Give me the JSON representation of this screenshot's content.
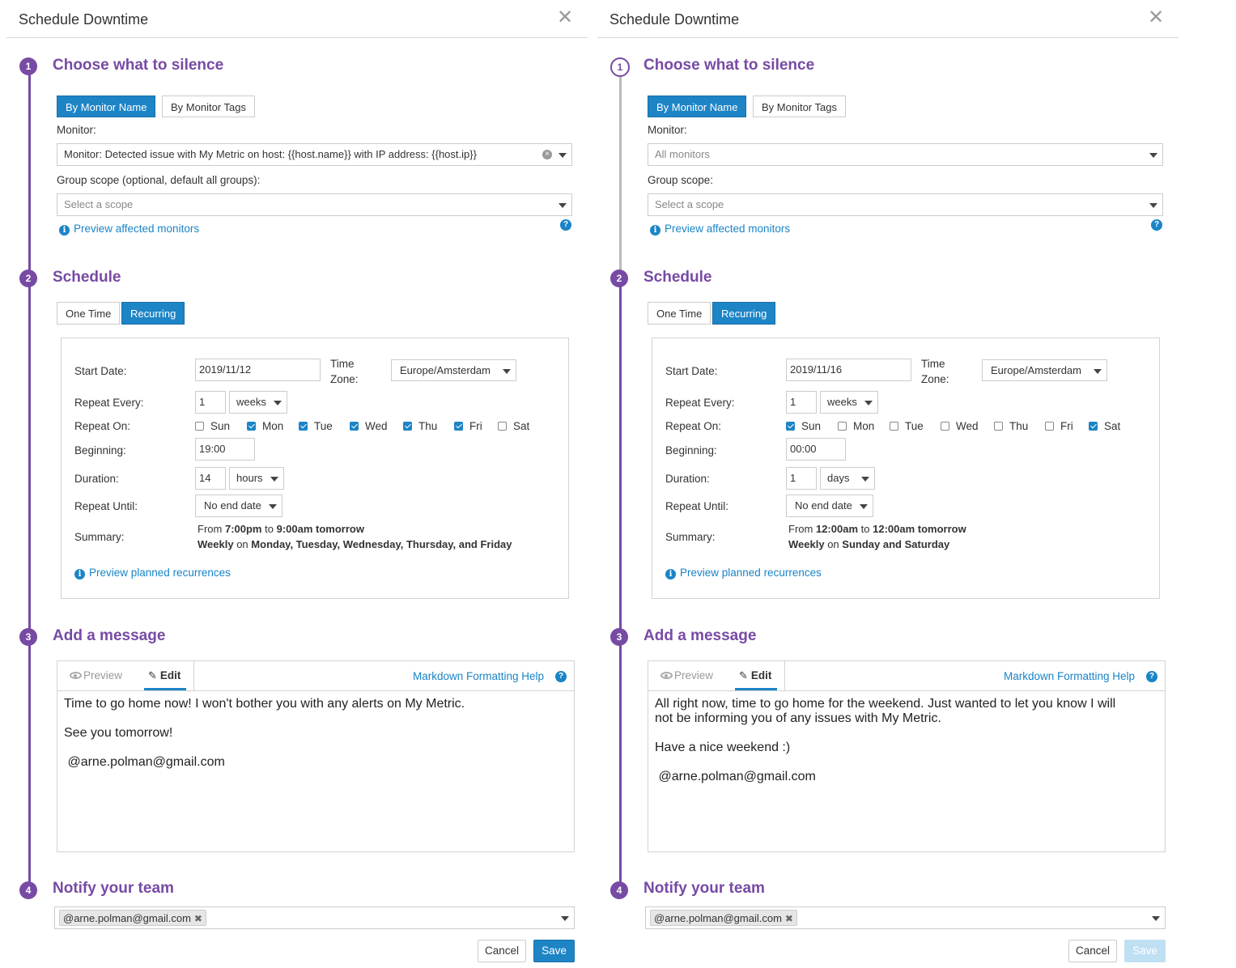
{
  "colors": {
    "accent": "#774aa4",
    "primary": "#1d84c6",
    "link": "#1a84c6"
  },
  "panels": [
    {
      "title": "Schedule Downtime",
      "sections": [
        "Choose what to silence",
        "Schedule",
        "Add a message",
        "Notify your team"
      ],
      "steps": [
        "1",
        "2",
        "3",
        "4"
      ],
      "silence": {
        "by_name": "By Monitor Name",
        "by_tags": "By Monitor Tags",
        "monitor_label": "Monitor:",
        "monitor_value": "Monitor: Detected issue with My Metric on host: {{host.name}} with IP address: {{host.ip}}",
        "group_label": "Group scope (optional, default all groups):",
        "group_placeholder": "Select a scope",
        "preview_link": "Preview affected monitors"
      },
      "schedule": {
        "one_time": "One Time",
        "recurring": "Recurring",
        "start_date_label": "Start Date:",
        "start_date": "2019/11/12",
        "timezone_label_1": "Time",
        "timezone_label_2": "Zone:",
        "timezone": "Europe/Amsterdam",
        "repeat_every_label": "Repeat Every:",
        "repeat_every": "1",
        "repeat_unit": "weeks",
        "repeat_on_label": "Repeat On:",
        "days": [
          {
            "label": "Sun",
            "checked": false
          },
          {
            "label": "Mon",
            "checked": true
          },
          {
            "label": "Tue",
            "checked": true
          },
          {
            "label": "Wed",
            "checked": true
          },
          {
            "label": "Thu",
            "checked": true
          },
          {
            "label": "Fri",
            "checked": true
          },
          {
            "label": "Sat",
            "checked": false
          }
        ],
        "beginning_label": "Beginning:",
        "beginning": "19:00",
        "duration_label": "Duration:",
        "duration": "14",
        "duration_unit": "hours",
        "until_label": "Repeat Until:",
        "until": "No end date",
        "summary_label": "Summary:",
        "summary": {
          "from": "From",
          "start": "7:00pm",
          "to": "to",
          "end": "9:00am tomorrow",
          "weekly": "Weekly",
          "on": "on",
          "days": "Monday, Tuesday, Wednesday, Thursday, and Friday"
        },
        "preview_link": "Preview planned recurrences"
      },
      "message": {
        "preview_tab": "Preview",
        "edit_tab": "Edit",
        "help_link": "Markdown Formatting Help",
        "text": "Time to go home now! I won't bother you with any alerts on My Metric.\n\nSee you tomorrow!\n\n @arne.polman@gmail.com"
      },
      "notify": {
        "tag": "@arne.polman@gmail.com"
      },
      "buttons": {
        "cancel": "Cancel",
        "save": "Save"
      }
    },
    {
      "title": "Schedule Downtime",
      "sections": [
        "Choose what to silence",
        "Schedule",
        "Add a message",
        "Notify your team"
      ],
      "steps": [
        "1",
        "2",
        "3",
        "4"
      ],
      "silence": {
        "by_name": "By Monitor Name",
        "by_tags": "By Monitor Tags",
        "monitor_label": "Monitor:",
        "monitor_placeholder": "All monitors",
        "group_label": "Group scope:",
        "group_placeholder": "Select a scope",
        "preview_link": "Preview affected monitors"
      },
      "schedule": {
        "one_time": "One Time",
        "recurring": "Recurring",
        "start_date_label": "Start Date:",
        "start_date": "2019/11/16",
        "timezone_label_1": "Time",
        "timezone_label_2": "Zone:",
        "timezone": "Europe/Amsterdam",
        "repeat_every_label": "Repeat Every:",
        "repeat_every": "1",
        "repeat_unit": "weeks",
        "repeat_on_label": "Repeat On:",
        "days": [
          {
            "label": "Sun",
            "checked": true
          },
          {
            "label": "Mon",
            "checked": false
          },
          {
            "label": "Tue",
            "checked": false
          },
          {
            "label": "Wed",
            "checked": false
          },
          {
            "label": "Thu",
            "checked": false
          },
          {
            "label": "Fri",
            "checked": false
          },
          {
            "label": "Sat",
            "checked": true
          }
        ],
        "beginning_label": "Beginning:",
        "beginning": "00:00",
        "duration_label": "Duration:",
        "duration": "1",
        "duration_unit": "days",
        "until_label": "Repeat Until:",
        "until": "No end date",
        "summary_label": "Summary:",
        "summary": {
          "from": "From",
          "start": "12:00am",
          "to": "to",
          "end": "12:00am tomorrow",
          "weekly": "Weekly",
          "on": "on",
          "days": "Sunday and Saturday"
        },
        "preview_link": "Preview planned recurrences"
      },
      "message": {
        "preview_tab": "Preview",
        "edit_tab": "Edit",
        "help_link": "Markdown Formatting Help",
        "text": "All right now, time to go home for the weekend. Just wanted to let you know I will\nnot be informing you of any issues with My Metric.\n\nHave a nice weekend :)\n\n @arne.polman@gmail.com"
      },
      "notify": {
        "tag": "@arne.polman@gmail.com"
      },
      "buttons": {
        "cancel": "Cancel",
        "save": "Save",
        "save_disabled": true
      }
    }
  ]
}
